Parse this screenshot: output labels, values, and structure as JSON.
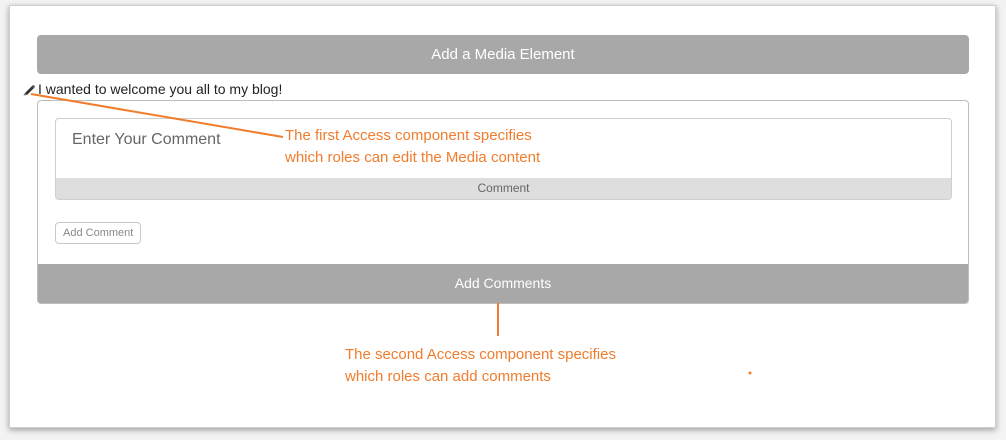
{
  "media_bar": {
    "label": "Add a Media Element"
  },
  "post": {
    "text": "I wanted to welcome you all to my blog!",
    "edit_icon": "pencil-icon"
  },
  "comment_form": {
    "placeholder": "Enter Your Comment",
    "field_label": "Comment",
    "add_button": "Add Comment"
  },
  "add_comments_bar": {
    "label": "Add Comments"
  },
  "annotations": {
    "first": {
      "line1": "The first Access component specifies",
      "line2": "which roles can edit the Media content"
    },
    "second": {
      "line1": "The second Access component specifies",
      "line2": "which roles can add comments"
    }
  },
  "colors": {
    "bar_gray": "#a8a8a8",
    "annotation_orange": "#f07c2c"
  }
}
